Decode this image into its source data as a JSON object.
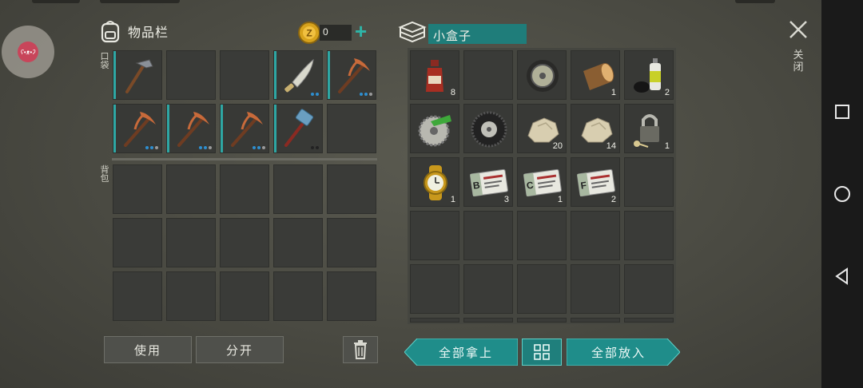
{
  "inventory": {
    "title": "物品栏",
    "pocket_label": "口袋",
    "backpack_label": "背包",
    "coins": "0",
    "add_symbol": "+",
    "pockets": [
      {
        "name": "pickaxe-hammer",
        "sel": true
      },
      {
        "name": "empty",
        "sel": false
      },
      {
        "name": "empty",
        "sel": false
      },
      {
        "name": "machete",
        "sel": true,
        "dots": [
          "b",
          "b"
        ]
      },
      {
        "name": "pickaxe",
        "sel": true,
        "dots": [
          "b",
          "b",
          "g"
        ]
      },
      {
        "name": "pickaxe",
        "sel": true,
        "dots": [
          "b",
          "b",
          "g"
        ]
      },
      {
        "name": "pickaxe",
        "sel": true,
        "dots": [
          "b",
          "b",
          "g"
        ]
      },
      {
        "name": "pickaxe",
        "sel": true,
        "dots": [
          "b",
          "b",
          "g"
        ]
      },
      {
        "name": "sledgehammer",
        "sel": true,
        "dots": [
          "d",
          "d"
        ]
      },
      {
        "name": "empty",
        "sel": false
      }
    ],
    "backpack_slots": 15,
    "use_label": "使用",
    "split_label": "分开"
  },
  "container": {
    "name": "小盒子",
    "items": [
      {
        "name": "bottle",
        "qty": "8"
      },
      {
        "name": "empty",
        "qty": ""
      },
      {
        "name": "wheel-disc",
        "qty": ""
      },
      {
        "name": "wood-log",
        "qty": "1"
      },
      {
        "name": "spray-can",
        "qty": "2"
      },
      {
        "name": "saw-blade",
        "qty": ""
      },
      {
        "name": "tire",
        "qty": ""
      },
      {
        "name": "stone",
        "qty": "20"
      },
      {
        "name": "stone",
        "qty": "14"
      },
      {
        "name": "padlock-key",
        "qty": "1"
      },
      {
        "name": "gold-watch",
        "qty": "1"
      },
      {
        "name": "army-card",
        "letter": "B",
        "qty": "3"
      },
      {
        "name": "army-card",
        "letter": "C",
        "qty": "1"
      },
      {
        "name": "army-card",
        "letter": "F",
        "qty": "2"
      },
      {
        "name": "empty",
        "qty": ""
      }
    ],
    "empty_rows": 3,
    "take_all_label": "全部拿上",
    "put_all_label": "全部放入",
    "close_label": "关闭"
  },
  "colors": {
    "accent": "#2ea7a4",
    "button_teal": "#1f8d8a",
    "panel": "#3a3b38"
  },
  "icons": [
    "backpack-icon",
    "coin-icon",
    "box-stack-icon",
    "close-icon",
    "trash-icon",
    "sort-grid-icon",
    "square-nav-icon",
    "circle-nav-icon",
    "back-nav-icon"
  ]
}
